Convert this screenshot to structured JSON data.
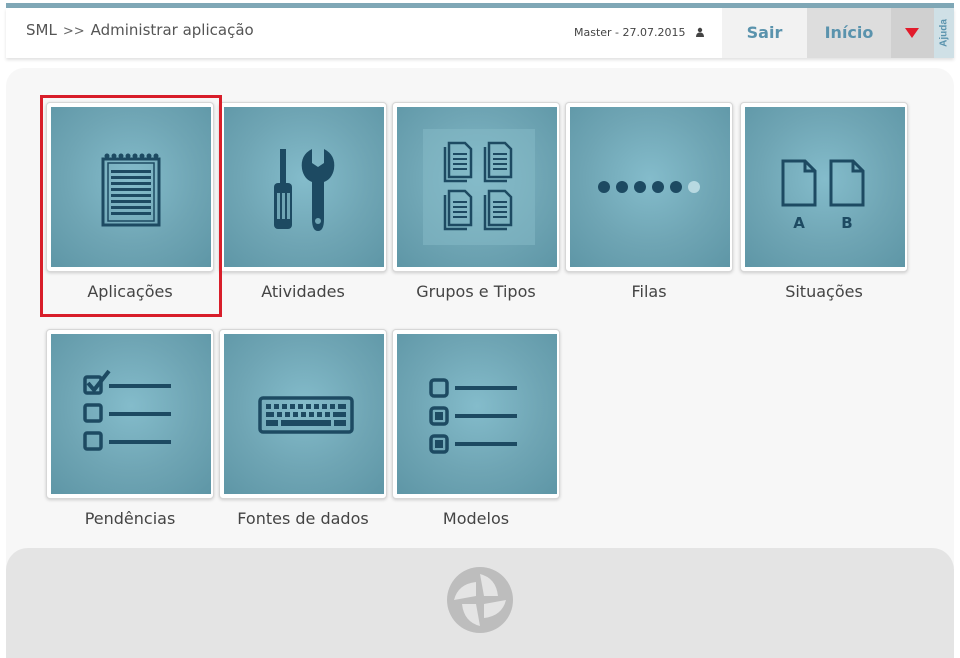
{
  "header": {
    "breadcrumb": {
      "root": "SML",
      "separator": ">>",
      "current": "Administrar aplicação"
    },
    "user": "Master - 27.07.2015",
    "sair_label": "Sair",
    "inicio_label": "Início",
    "ajuda_label": "Ajuda"
  },
  "tiles": [
    {
      "label": "Aplicações",
      "icon": "notepad-icon",
      "selected": true
    },
    {
      "label": "Atividades",
      "icon": "tools-icon"
    },
    {
      "label": "Grupos e Tipos",
      "icon": "documents-grid-icon"
    },
    {
      "label": "Filas",
      "icon": "dots-queue-icon"
    },
    {
      "label": "Situações",
      "icon": "pages-ab-icon"
    },
    {
      "label": "Pendências",
      "icon": "checklist-icon"
    },
    {
      "label": "Fontes de dados",
      "icon": "keyboard-icon"
    },
    {
      "label": "Modelos",
      "icon": "radio-list-icon"
    }
  ],
  "colors": {
    "accent": "#5a93ad",
    "tile": "#6fa5b4",
    "icon": "#1d4a62",
    "highlight": "#d81e2a",
    "menu_arrow": "#e21b2b"
  }
}
